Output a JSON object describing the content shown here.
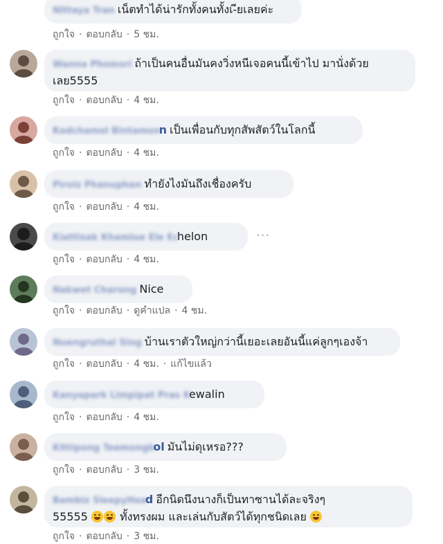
{
  "comments": [
    {
      "name": "Nittaya Tran",
      "name_tail": "",
      "text": "เน็ตทำได้น่ารักทั้งคนทั้งเ-ียเลยค่ะ",
      "text2": "",
      "like": "ถูกใจ",
      "reply": "ตอบกลับ",
      "extra": "",
      "time": "5 ชม.",
      "edited": "",
      "avatar_colors": [
        "#a9b8c9",
        "#6d7f94"
      ]
    },
    {
      "name": "Wanna Phomsri",
      "name_tail": "",
      "text": "ถ้าเป็นคนอื่นมันคงวิ่งหนีเจอคนนี้เข้าไป มานั่งด้วย",
      "text2": "เลย5555",
      "like": "ถูกใจ",
      "reply": "ตอบกลับ",
      "extra": "",
      "time": "4 ชม.",
      "edited": "",
      "avatar_colors": [
        "#b8a899",
        "#5c4c41"
      ]
    },
    {
      "name": "Kodchamol Bintamon",
      "name_tail": "n",
      "text": "เป็นเพื่อนกับทุกสัพสัตว์ในโลกนี้",
      "text2": "",
      "like": "ถูกใจ",
      "reply": "ตอบกลับ",
      "extra": "",
      "time": "4 ชม.",
      "edited": "",
      "avatar_colors": [
        "#d7a7a0",
        "#7b4036"
      ]
    },
    {
      "name": "Piroiz Phanuphan",
      "name_tail": "",
      "text": "ทำยังไงมันถึงเชื่องครับ",
      "text2": "",
      "like": "ถูกใจ",
      "reply": "ตอบกลับ",
      "extra": "",
      "time": "4 ชม.",
      "edited": "",
      "avatar_colors": [
        "#d9c1a8",
        "#6e5a48"
      ]
    },
    {
      "name": "Kiattisak Khamlue Ele Ec",
      "name_tail": "helon",
      "text": "",
      "text2": "",
      "like": "ถูกใจ",
      "reply": "ตอบกลับ",
      "extra": "",
      "time": "4 ชม.",
      "edited": "",
      "avatar_colors": [
        "#4a4a4a",
        "#1c1c1c"
      ],
      "more": "···"
    },
    {
      "name": "Nakwet Charong",
      "name_tail": "",
      "text": "Nice",
      "text2": "",
      "like": "ถูกใจ",
      "reply": "ตอบกลับ",
      "extra": "ดูคำแปล",
      "time": "4 ชม.",
      "edited": "",
      "avatar_colors": [
        "#5d7c5a",
        "#23361f"
      ]
    },
    {
      "name": "Nuengruthai Sing",
      "name_tail": "",
      "text": "บ้านเราตัวใหญ่กว่านี้เยอะเลยอันนี้แค่ลูกๆเองจ้า",
      "text2": "",
      "like": "ถูกใจ",
      "reply": "ตอบกลับ",
      "extra": "",
      "time": "4 ชม.",
      "edited": "แก้ไขแล้ว",
      "avatar_colors": [
        "#b8c3d6",
        "#6f6a8a"
      ]
    },
    {
      "name": "Kanyapark Limpipat Pras K",
      "name_tail": "ewalin",
      "text": "",
      "text2": "",
      "like": "ถูกใจ",
      "reply": "ตอบกลับ",
      "extra": "",
      "time": "4 ชม.",
      "edited": "",
      "avatar_colors": [
        "#a8b8cc",
        "#4d5f7a"
      ]
    },
    {
      "name": "Kittipong Teemongk",
      "name_tail": "ol",
      "text": "มันไม่ดุเหรอ???",
      "text2": "",
      "like": "ถูกใจ",
      "reply": "ตอบกลับ",
      "extra": "",
      "time": "3 ชม.",
      "edited": "",
      "avatar_colors": [
        "#c9b0a0",
        "#7a5d4d"
      ]
    },
    {
      "name": "Bambiz SleepyHea",
      "name_tail": "d",
      "text": "อีกนิดนึงนางก็เป็นทาซานได้ละจริงๆ",
      "text2_before": "55555",
      "text2_after": "ทั้งทรงผม และเล่นกับสัตว์ได้ทุกชนิดเลย",
      "like": "ถูกใจ",
      "reply": "ตอบกลับ",
      "extra": "",
      "time": "3 ชม.",
      "edited": "",
      "avatar_colors": [
        "#c2b69f",
        "#5a4e3c"
      ]
    }
  ]
}
